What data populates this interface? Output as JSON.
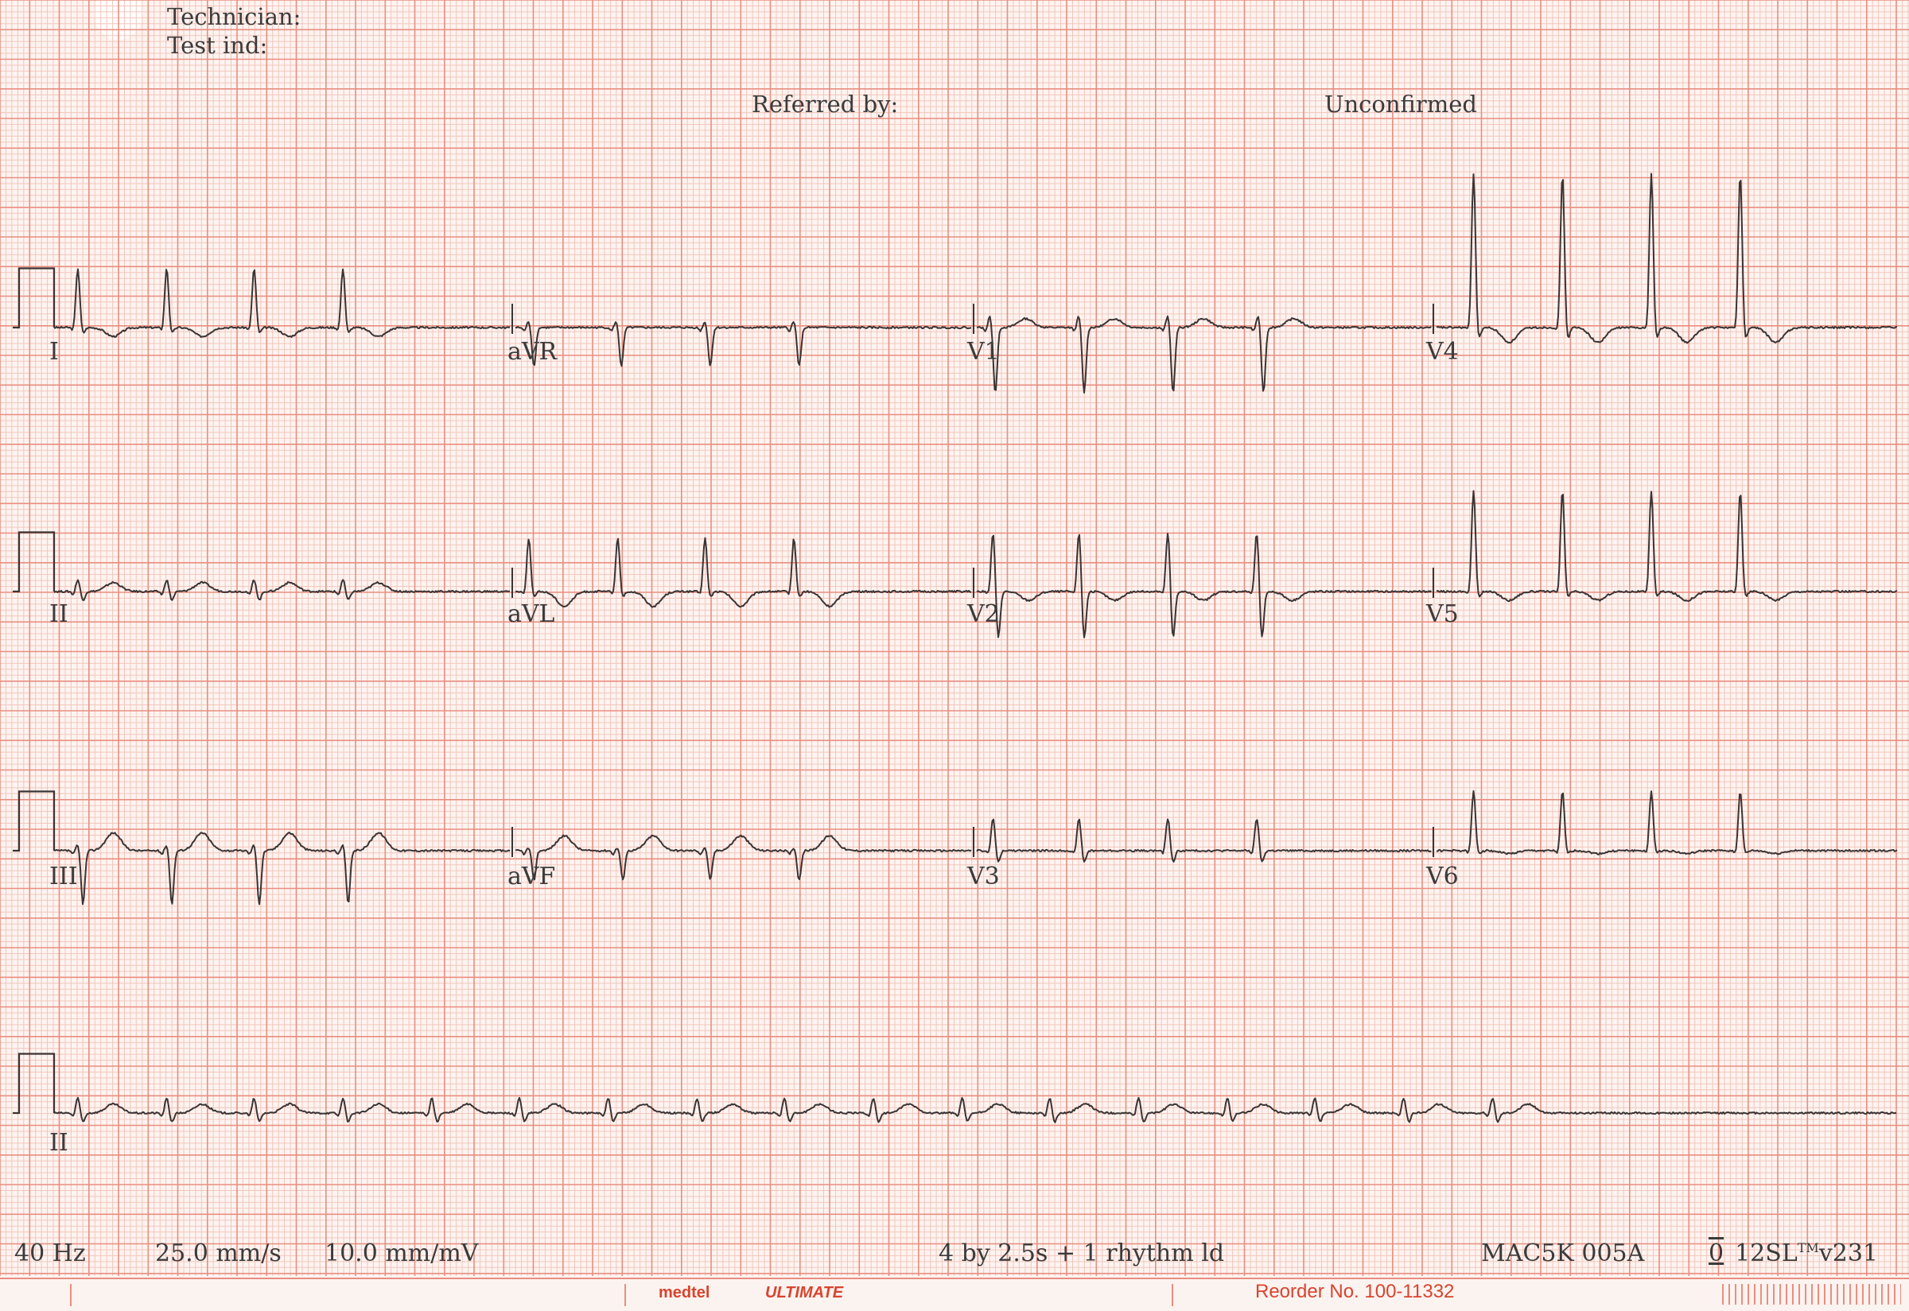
{
  "header": {
    "technician_label": "Technician:",
    "test_ind_label": "Test ind:",
    "referred_by_label": "Referred by:",
    "status": "Unconfirmed"
  },
  "leads": {
    "I": "I",
    "aVR": "aVR",
    "V1": "V1",
    "V4": "V4",
    "II": "II",
    "aVL": "aVL",
    "V2": "V2",
    "V5": "V5",
    "III": "III",
    "aVF": "aVF",
    "V3": "V3",
    "V6": "V6",
    "rhythm": "II"
  },
  "footer": {
    "filter": "40 Hz",
    "speed": "25.0 mm/s",
    "gain": "10.0 mm/mV",
    "format": "4 by 2.5s + 1 rhythm ld",
    "device": "MAC5K 005A",
    "program_symbol": "0",
    "program": "12SL",
    "trademark": "TM",
    "version": "v231"
  },
  "paper": {
    "brand": "medtel",
    "product": "ULTIMATE",
    "reorder": "Reorder No. 100-11332"
  },
  "colors": {
    "grid_minor": "#f2c6bc",
    "grid_major": "#e98e80",
    "trace": "#3a3434",
    "paper": "#fdf4f1"
  },
  "chart_data": {
    "type": "line",
    "paper_speed_mm_per_s": 25,
    "gain_mm_per_mV": 10,
    "layout": "4 by 2.5s + 1 rhythm ld",
    "calibration_pulse_mV": 1.0,
    "series": [
      {
        "name": "I",
        "lead": "I",
        "row": 0,
        "col": 0,
        "beat_times_s": [
          0.16,
          0.76,
          1.35,
          1.95
        ],
        "r_mV": 1.0,
        "s_mV": -0.1,
        "t_mV": -0.15,
        "p_mV": 0.0
      },
      {
        "name": "aVR",
        "lead": "aVR",
        "row": 0,
        "col": 1,
        "beat_times_s": [
          0.09,
          0.68,
          1.28,
          1.88
        ],
        "r_mV": 0.1,
        "s_mV": -0.65,
        "t_mV": 0.0,
        "p_mV": 0.0
      },
      {
        "name": "V1",
        "lead": "V1",
        "row": 0,
        "col": 2,
        "beat_times_s": [
          0.09,
          0.69,
          1.29,
          1.9
        ],
        "r_mV": 0.2,
        "s_mV": -1.1,
        "t_mV": 0.15,
        "p_mV": 0.0
      },
      {
        "name": "V4",
        "lead": "V4",
        "row": 0,
        "col": 3,
        "beat_times_s": [
          0.25,
          0.85,
          1.45,
          2.05
        ],
        "r_mV": 2.6,
        "s_mV": -0.2,
        "t_mV": -0.25,
        "p_mV": 0.0
      },
      {
        "name": "II",
        "lead": "II",
        "row": 1,
        "col": 0,
        "beat_times_s": [
          0.16,
          0.76,
          1.35,
          1.95
        ],
        "r_mV": 0.2,
        "s_mV": -0.15,
        "t_mV": 0.15,
        "p_mV": 0.0
      },
      {
        "name": "aVL",
        "lead": "aVL",
        "row": 1,
        "col": 1,
        "beat_times_s": [
          0.09,
          0.69,
          1.28,
          1.88
        ],
        "r_mV": 0.9,
        "s_mV": -0.1,
        "t_mV": -0.25,
        "p_mV": 0.0
      },
      {
        "name": "V2",
        "lead": "V2",
        "row": 1,
        "col": 2,
        "beat_times_s": [
          0.11,
          0.69,
          1.29,
          1.89
        ],
        "r_mV": 1.0,
        "s_mV": -0.8,
        "t_mV": -0.15,
        "p_mV": 0.0
      },
      {
        "name": "V5",
        "lead": "V5",
        "row": 1,
        "col": 3,
        "beat_times_s": [
          0.25,
          0.85,
          1.45,
          2.05
        ],
        "r_mV": 1.7,
        "s_mV": -0.1,
        "t_mV": -0.15,
        "p_mV": 0.0
      },
      {
        "name": "III",
        "lead": "III",
        "row": 2,
        "col": 0,
        "beat_times_s": [
          0.16,
          0.76,
          1.35,
          1.95
        ],
        "r_mV": 0.1,
        "s_mV": -0.9,
        "t_mV": 0.3,
        "p_mV": 0.0
      },
      {
        "name": "aVF",
        "lead": "aVF",
        "row": 2,
        "col": 1,
        "beat_times_s": [
          0.09,
          0.69,
          1.28,
          1.88
        ],
        "r_mV": 0.05,
        "s_mV": -0.5,
        "t_mV": 0.25,
        "p_mV": 0.0
      },
      {
        "name": "V3",
        "lead": "V3",
        "row": 2,
        "col": 2,
        "beat_times_s": [
          0.11,
          0.69,
          1.29,
          1.89
        ],
        "r_mV": 0.55,
        "s_mV": -0.2,
        "t_mV": 0.0,
        "p_mV": 0.0
      },
      {
        "name": "V6",
        "lead": "V6",
        "row": 2,
        "col": 3,
        "beat_times_s": [
          0.25,
          0.85,
          1.45,
          2.05
        ],
        "r_mV": 1.0,
        "s_mV": -0.05,
        "t_mV": -0.05,
        "p_mV": 0.0
      },
      {
        "name": "II",
        "lead": "II rhythm",
        "row": 3,
        "col": 0,
        "beat_times_s": [
          0.16,
          0.76,
          1.35,
          1.95,
          2.55,
          3.14,
          3.74,
          4.34,
          4.93,
          5.53,
          6.13,
          6.72,
          7.32,
          7.92,
          8.51,
          9.11,
          9.71
        ],
        "r_mV": 0.25,
        "s_mV": -0.15,
        "t_mV": 0.15,
        "p_mV": 0.0
      }
    ]
  }
}
